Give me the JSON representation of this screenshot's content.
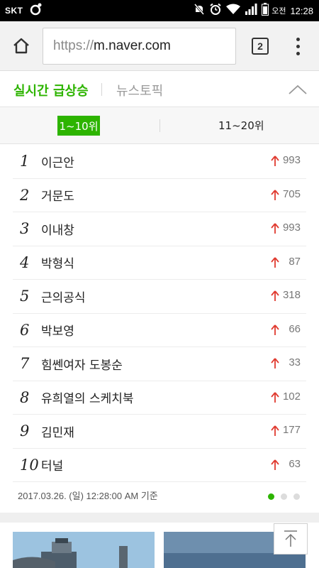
{
  "status_bar": {
    "carrier": "SKT",
    "time": "12:28",
    "ampm": "오전",
    "icons": [
      "notification-icon",
      "mute-icon",
      "alarm-icon",
      "wifi-icon",
      "signal-icon",
      "battery-icon"
    ]
  },
  "browser": {
    "url_scheme": "https://",
    "url_host": "m.naver.com",
    "tab_count": "2"
  },
  "topics": {
    "realtime_tab": "실시간 급상승",
    "news_tab": "뉴스토픽"
  },
  "ranges": {
    "active": "1~10위",
    "other": "11~20위"
  },
  "ranks": [
    {
      "num": "1",
      "keyword": "이근안",
      "change": "993"
    },
    {
      "num": "2",
      "keyword": "거문도",
      "change": "705"
    },
    {
      "num": "3",
      "keyword": "이내창",
      "change": "993"
    },
    {
      "num": "4",
      "keyword": "박형식",
      "change": "87"
    },
    {
      "num": "5",
      "keyword": "근의공식",
      "change": "318"
    },
    {
      "num": "6",
      "keyword": "박보영",
      "change": "66"
    },
    {
      "num": "7",
      "keyword": "힘쎈여자 도봉순",
      "change": "33"
    },
    {
      "num": "8",
      "keyword": "유희열의 스케치북",
      "change": "102"
    },
    {
      "num": "9",
      "keyword": "김민재",
      "change": "177"
    },
    {
      "num": "10",
      "keyword": "터널",
      "change": "63"
    }
  ],
  "footer": {
    "timestamp": "2017.03.26. (일) 12:28:00 AM 기준"
  },
  "colors": {
    "accent": "#2db400",
    "up_arrow": "#e03a2f"
  }
}
